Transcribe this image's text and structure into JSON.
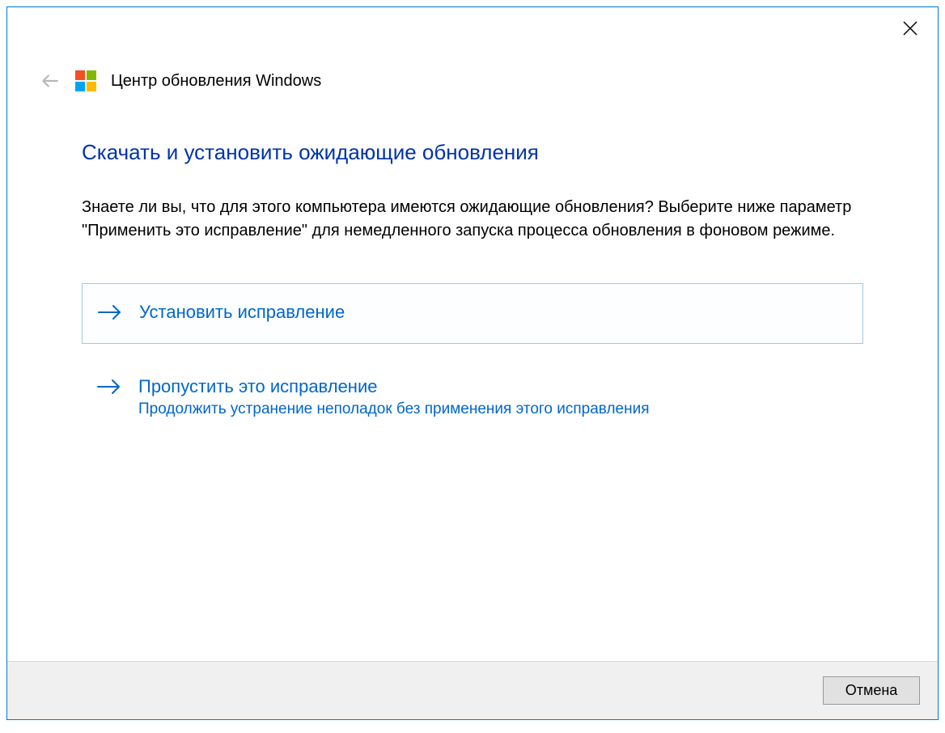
{
  "header": {
    "title": "Центр обновления Windows"
  },
  "main": {
    "heading": "Скачать и установить ожидающие обновления",
    "description": "Знаете ли вы, что для этого компьютера имеются ожидающие обновления? Выберите ниже параметр \"Применить это исправление\" для немедленного запуска процесса обновления в фоновом режиме."
  },
  "options": [
    {
      "title": "Установить исправление",
      "subtitle": ""
    },
    {
      "title": "Пропустить это исправление",
      "subtitle": "Продолжить устранение неполадок без применения этого исправления"
    }
  ],
  "footer": {
    "cancel": "Отмена"
  }
}
